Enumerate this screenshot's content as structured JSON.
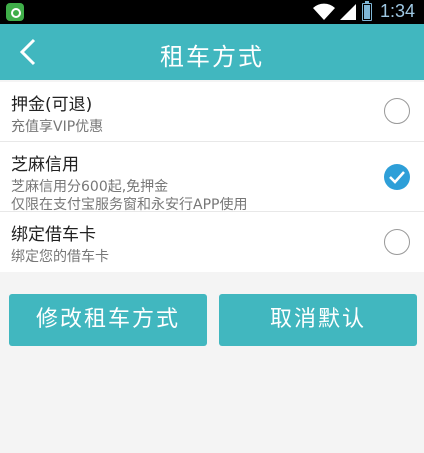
{
  "status_bar": {
    "time": "1:34"
  },
  "header": {
    "title": "租车方式",
    "back_icon": "chevron-left-icon"
  },
  "options": [
    {
      "title": "押金(可退)",
      "subtitle": "充值享VIP优惠",
      "checked": false
    },
    {
      "title": "芝麻信用",
      "subtitle": "芝麻信用分600起,免押金",
      "subtitle2": "仅限在支付宝服务窗和永安行APP使用",
      "checked": true
    },
    {
      "title": "绑定借车卡",
      "subtitle": "绑定您的借车卡",
      "checked": false
    }
  ],
  "buttons": {
    "modify_label": "修改租车方式",
    "cancel_default_label": "取消默认"
  },
  "colors": {
    "header": "#41b7bf",
    "button": "#41b7bf",
    "radio_checked": "#2e9fd8"
  }
}
